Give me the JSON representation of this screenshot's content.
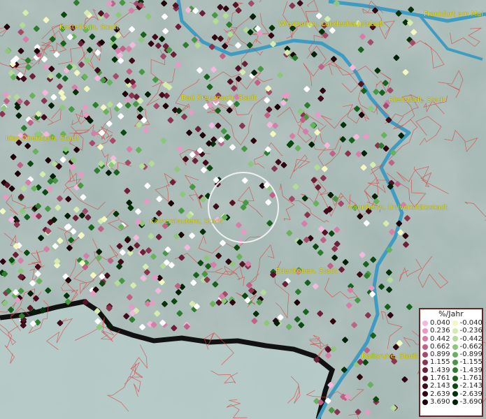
{
  "cities": [
    {
      "name": "Kastellaun, Stadt"
    },
    {
      "name": "Wiesbaden, Landeshauptstadt"
    },
    {
      "name": "Frankfurt am Mai"
    },
    {
      "name": "Bad Kreuznach, Stadt"
    },
    {
      "name": "Riedstadt, Stadt"
    },
    {
      "name": "Idar-Oberstein, Stadt"
    },
    {
      "name": "Mannheim, Universitätsstadt"
    },
    {
      "name": "Kaiserslautern, Stadt"
    },
    {
      "name": "Edenkoben, Stadt"
    },
    {
      "name": "Karlsruhe, Stadt"
    }
  ],
  "legend": {
    "title": "%/Jahr",
    "positive": [
      {
        "label": "0.040",
        "color": "#f4b8dc"
      },
      {
        "label": "0.236",
        "color": "#e79ac3"
      },
      {
        "label": "0.442",
        "color": "#d77da8"
      },
      {
        "label": "0.662",
        "color": "#c06287"
      },
      {
        "label": "0.899",
        "color": "#a54a69"
      },
      {
        "label": "1.155",
        "color": "#8a344f"
      },
      {
        "label": "1.439",
        "color": "#6e1f38"
      },
      {
        "label": "1.761",
        "color": "#561326"
      },
      {
        "label": "2.143",
        "color": "#420b1a"
      },
      {
        "label": "2.639",
        "color": "#300510"
      },
      {
        "label": "3.690",
        "color": "#1e0208"
      }
    ],
    "negative": [
      {
        "label": "-0.040",
        "color": "#f2f8c0"
      },
      {
        "label": "-0.236",
        "color": "#d5ecae"
      },
      {
        "label": "-0.442",
        "color": "#b3dc96"
      },
      {
        "label": "-0.662",
        "color": "#8dc77a"
      },
      {
        "label": "-0.899",
        "color": "#68b15d"
      },
      {
        "label": "-1.155",
        "color": "#479843"
      },
      {
        "label": "-1.439",
        "color": "#2c7e2e"
      },
      {
        "label": "-1.761",
        "color": "#17631d"
      },
      {
        "label": "-2.143",
        "color": "#0a4a11"
      },
      {
        "label": "-2.639",
        "color": "#04330a"
      },
      {
        "label": "-3.690",
        "color": "#012005"
      }
    ]
  }
}
